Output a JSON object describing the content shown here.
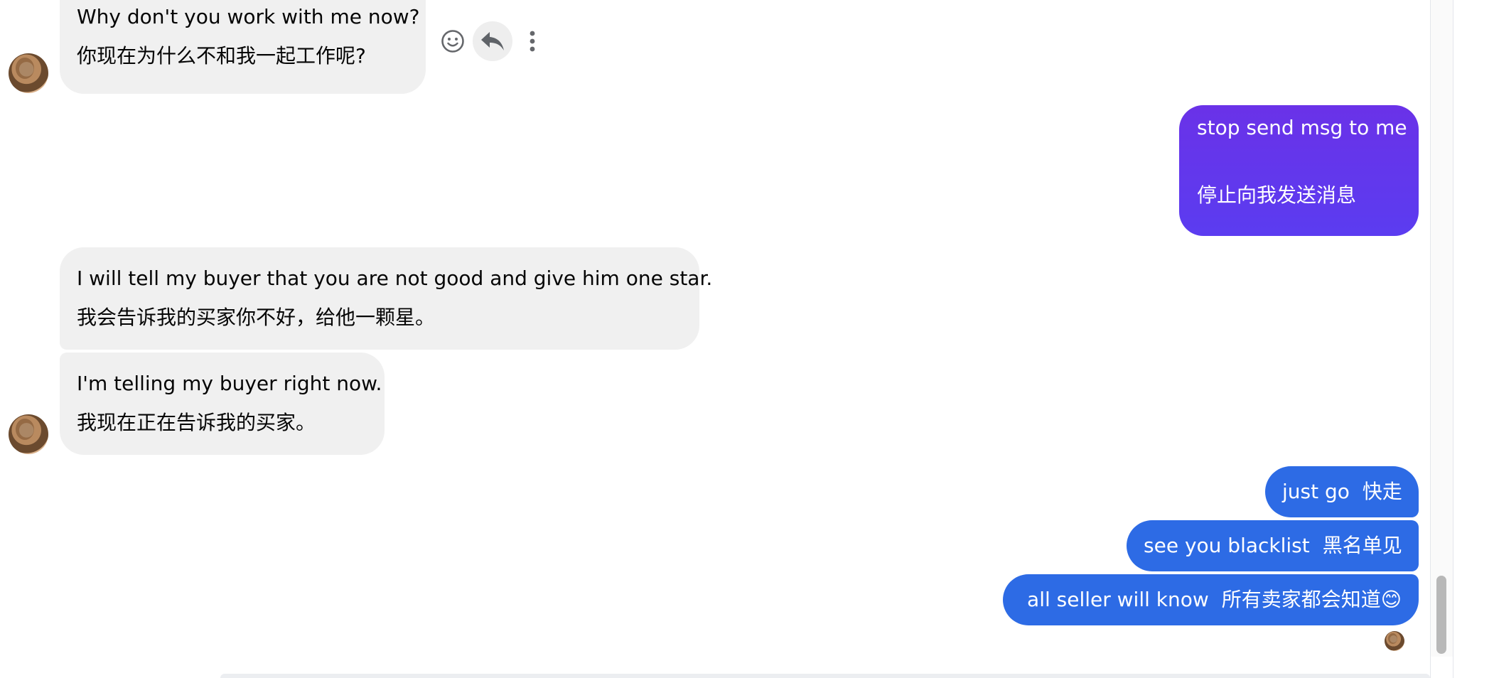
{
  "messages": {
    "m1": {
      "en": "Why don't you work with me now?",
      "zh": "你现在为什么不和我一起工作呢?"
    },
    "m2": {
      "en": "stop send msg to me",
      "zh": "停止向我发送消息"
    },
    "m3": {
      "en": "I will tell my buyer that you are not good and give him one star.",
      "zh": "我会告诉我的买家你不好，给他一颗星。"
    },
    "m4": {
      "en": "I'm telling my buyer right now.",
      "zh": "我现在正在告诉我的买家。"
    },
    "m5": {
      "en": "just go",
      "zh": "快走"
    },
    "m6": {
      "en": "see you blacklist",
      "zh": "黑名单见"
    },
    "m7": {
      "en": "all seller will know",
      "zh": "所有卖家都会知道😊"
    }
  },
  "actions": {
    "react": "smiley-icon",
    "reply": "reply-icon",
    "more": "more-vertical-icon"
  },
  "colors": {
    "incoming": "#f0f0f0",
    "outgoing_purple": "#6a32e8",
    "outgoing_blue": "#2d6be5"
  }
}
